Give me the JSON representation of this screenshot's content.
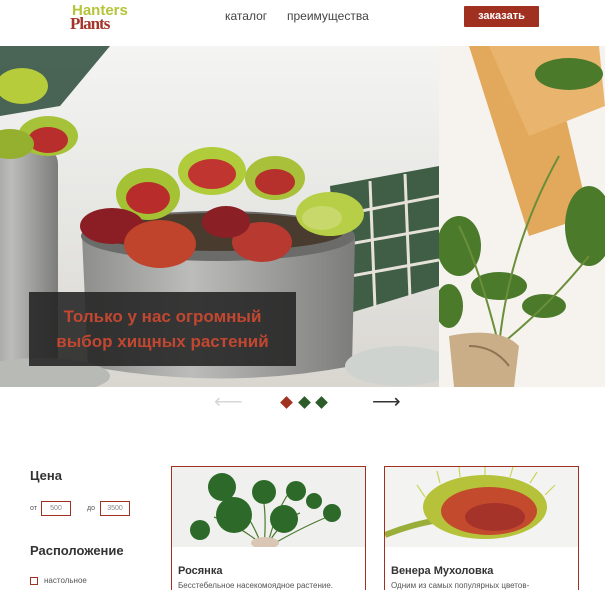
{
  "header": {
    "logo_top": "Hanters",
    "logo_bottom": "Plants",
    "nav": [
      {
        "label": "каталог"
      },
      {
        "label": "преимущества"
      }
    ],
    "order_label": "заказать"
  },
  "hero": {
    "caption": "Только у нас огромный выбор хищных растений",
    "slides_count": 3,
    "active_slide": 1,
    "prev_arrow": "⟵",
    "next_arrow": "⟶"
  },
  "colors": {
    "accent": "#a03121",
    "logo_green": "#b6c43a",
    "dot_active": "#a03121",
    "dot_inactive": "#2e5b2a",
    "caption_text": "#c24730"
  },
  "filters": {
    "price": {
      "title": "Цена",
      "from_label": "от",
      "from_value": "500",
      "to_label": "до",
      "to_value": "3500"
    },
    "location": {
      "title": "Расположение",
      "options": [
        {
          "label": "настольное",
          "checked": false
        }
      ]
    }
  },
  "products": [
    {
      "name": "Росянка",
      "description": "Бесстебельное насекомоядное растение.",
      "icon": "pilea-plant-image"
    },
    {
      "name": "Венера Мухоловка",
      "description": "Одним из самых популярных цветов-",
      "icon": "flytrap-image"
    }
  ]
}
